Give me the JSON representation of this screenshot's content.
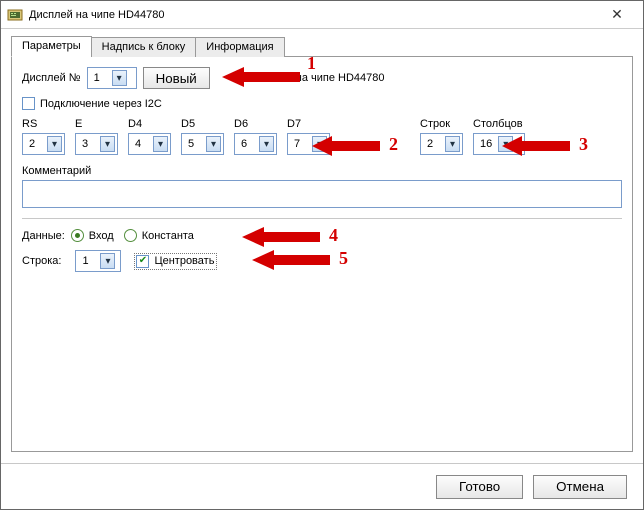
{
  "window": {
    "title": "Дисплей на чипе HD44780",
    "close": "✕"
  },
  "tabs": {
    "t0": "Параметры",
    "t1": "Надпись к блоку",
    "t2": "Информация"
  },
  "form": {
    "display_no_label": "Дисплей №",
    "display_no_value": "1",
    "new_button": "Новый",
    "template_text": "на чипе HD44780",
    "i2c_checkbox": "Подключение через I2C",
    "i2c_checked": "",
    "pins": {
      "rs": {
        "label": "RS",
        "value": "2"
      },
      "e": {
        "label": "E",
        "value": "3"
      },
      "d4": {
        "label": "D4",
        "value": "4"
      },
      "d5": {
        "label": "D5",
        "value": "5"
      },
      "d6": {
        "label": "D6",
        "value": "6"
      },
      "d7": {
        "label": "D7",
        "value": "7"
      }
    },
    "rows": {
      "label": "Строк",
      "value": "2"
    },
    "columns": {
      "label": "Столбцов",
      "value": "16"
    },
    "comment_label": "Комментарий",
    "data_label": "Данные:",
    "radio_input": "Вход",
    "radio_const": "Константа",
    "row_label": "Строка:",
    "row_value": "1",
    "center_checkbox": "Центровать",
    "center_checked": "✔"
  },
  "footer": {
    "ok": "Готово",
    "cancel": "Отмена"
  },
  "annotations": {
    "n1": "1",
    "n2": "2",
    "n3": "3",
    "n4": "4",
    "n5": "5"
  }
}
